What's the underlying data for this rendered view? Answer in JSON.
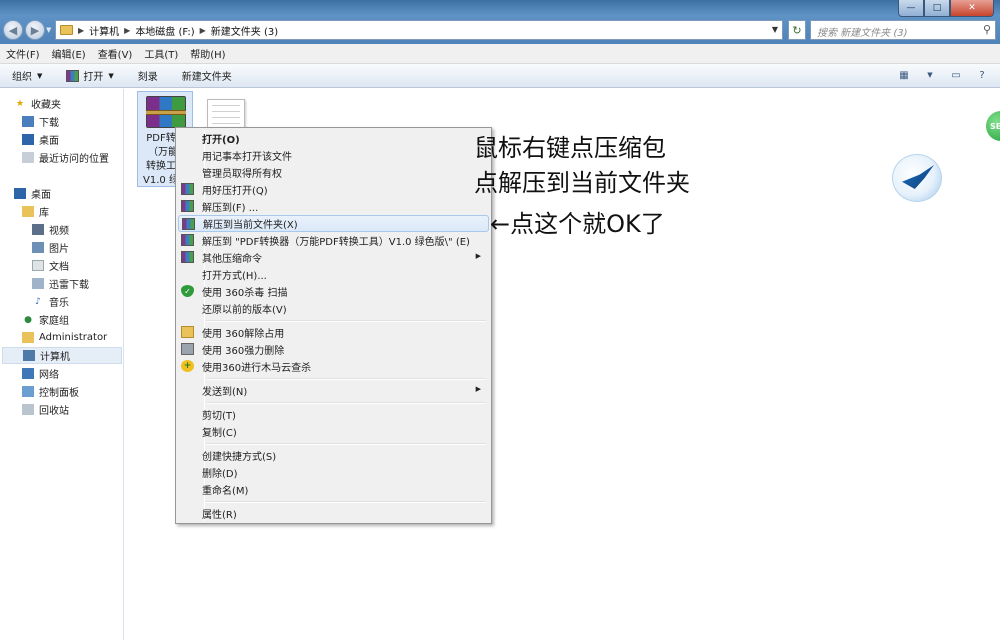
{
  "window": {
    "controls": {
      "minimize": "—",
      "maximize": "□",
      "close": "✕"
    }
  },
  "address": {
    "breadcrumbs": [
      "计算机",
      "本地磁盘 (F:)",
      "新建文件夹 (3)"
    ],
    "search_placeholder": "搜索 新建文件夹 (3)"
  },
  "menubar": {
    "items": [
      "文件(F)",
      "编辑(E)",
      "查看(V)",
      "工具(T)",
      "帮助(H)"
    ]
  },
  "toolbar": {
    "organize": "组织",
    "open": "打开",
    "burn": "刻录",
    "new_folder": "新建文件夹"
  },
  "navpane": {
    "items": [
      {
        "label": "收藏夹",
        "icon": "star-icon"
      },
      {
        "label": "下载",
        "icon": "download-folder-icon"
      },
      {
        "label": "桌面",
        "icon": "desktop-icon"
      },
      {
        "label": "最近访问的位置",
        "icon": "recent-places-icon"
      },
      {
        "label": "桌面",
        "icon": "desktop-icon"
      },
      {
        "label": "库",
        "icon": "libraries-icon"
      },
      {
        "label": "视频",
        "icon": "video-icon"
      },
      {
        "label": "图片",
        "icon": "pictures-icon"
      },
      {
        "label": "文档",
        "icon": "documents-icon"
      },
      {
        "label": "迅雷下载",
        "icon": "thunder-download-icon"
      },
      {
        "label": "音乐",
        "icon": "music-icon"
      },
      {
        "label": "家庭组",
        "icon": "homegroup-icon"
      },
      {
        "label": "Administrator",
        "icon": "user-folder-icon"
      },
      {
        "label": "计算机",
        "icon": "computer-icon"
      },
      {
        "label": "网络",
        "icon": "network-icon"
      },
      {
        "label": "控制面板",
        "icon": "control-panel-icon"
      },
      {
        "label": "回收站",
        "icon": "recycle-bin-icon"
      }
    ]
  },
  "files": {
    "rar_name": "PDF转换\n（万能P\n转换工具\nV1.0 绿色"
  },
  "context_menu": {
    "items": [
      {
        "label": "打开(O)",
        "bold": true
      },
      {
        "label": "用记事本打开该文件"
      },
      {
        "label": "管理员取得所有权"
      },
      {
        "label": "用好压打开(Q)",
        "icon": "haozip-icon"
      },
      {
        "label": "解压到(F) ...",
        "icon": "haozip-icon"
      },
      {
        "label": "解压到当前文件夹(X)",
        "icon": "haozip-icon",
        "highlighted": true
      },
      {
        "label": "解压到 \"PDF转换器（万能PDF转换工具）V1.0 绿色版\\\" (E)",
        "icon": "haozip-icon"
      },
      {
        "label": "其他压缩命令",
        "icon": "haozip-icon",
        "submenu": true
      },
      {
        "label": "打开方式(H)..."
      },
      {
        "label": "使用 360杀毒 扫描",
        "icon": "360-shield-icon"
      },
      {
        "label": "还原以前的版本(V)"
      },
      {
        "label": "使用 360解除占用",
        "icon": "360-unlock-icon"
      },
      {
        "label": "使用 360强力删除",
        "icon": "360-shred-icon"
      },
      {
        "label": "使用360进行木马云查杀",
        "icon": "360-cloud-scan-icon"
      },
      {
        "label": "发送到(N)",
        "submenu": true
      },
      {
        "label": "剪切(T)"
      },
      {
        "label": "复制(C)"
      },
      {
        "label": "创建快捷方式(S)"
      },
      {
        "label": "删除(D)"
      },
      {
        "label": "重命名(M)"
      },
      {
        "label": "属性(R)"
      }
    ]
  },
  "annotations": {
    "line1": "鼠标右键点压缩包",
    "line2": "点解压到当前文件夹",
    "arrow_note": "←点这个就OK了"
  },
  "colors": {
    "title_bar": "#4f82b8",
    "selection_highlight": "#dae8f8"
  }
}
